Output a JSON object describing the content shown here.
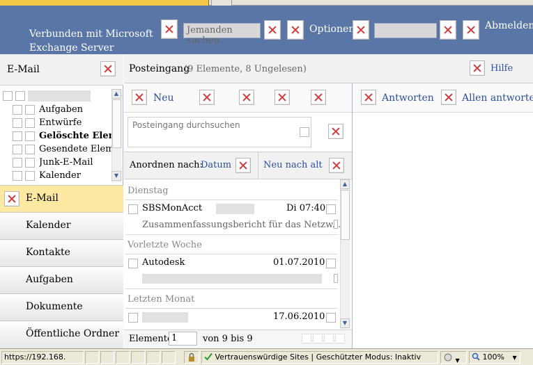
{
  "header": {
    "connected_line1": "Verbunden mit Microsoft",
    "connected_line2": "Exchange Server",
    "search_people": "Jemanden suchen",
    "options": "Optionen",
    "logout": "Abmelden"
  },
  "left": {
    "title": "E-Mail",
    "folders": [
      "Aufgaben",
      "Entwürfe",
      "Gelöschte Elemente",
      "Gesendete Elemente",
      "Junk-E-Mail",
      "Kalender"
    ],
    "nav": [
      "E-Mail",
      "Kalender",
      "Kontakte",
      "Aufgaben",
      "Dokumente",
      "Öffentliche Ordner"
    ]
  },
  "inbox": {
    "title": "Posteingang",
    "count": "(9 Elemente,  8 Ungelesen)",
    "help": "Hilfe",
    "new": "Neu",
    "search_placeholder": "Posteingang durchsuchen",
    "sort_label": "Anordnen nach:",
    "sort_field": "Datum",
    "sort_order": "Neu nach alt",
    "groups": [
      "Dienstag",
      "Vorletzte Woche",
      "Letzten Monat"
    ],
    "messages": [
      {
        "sender": "SBSMonAcct",
        "date": "Di 07:40",
        "preview": "Zusammenfassungsbericht für das Netzw..."
      },
      {
        "sender": "Autodesk",
        "date": "01.07.2010",
        "preview": ""
      },
      {
        "sender": "",
        "date": "17.06.2010",
        "preview": ""
      }
    ],
    "items_label": "Elemente",
    "items_value": "1",
    "items_range": "von 9 bis 9"
  },
  "reading": {
    "reply": "Antworten",
    "reply_all": "Allen antworten"
  },
  "status": {
    "url": "https://192.168.",
    "zone": "Vertrauenswürdige Sites | Geschützter Modus: Inaktiv",
    "zoom": "100%"
  }
}
